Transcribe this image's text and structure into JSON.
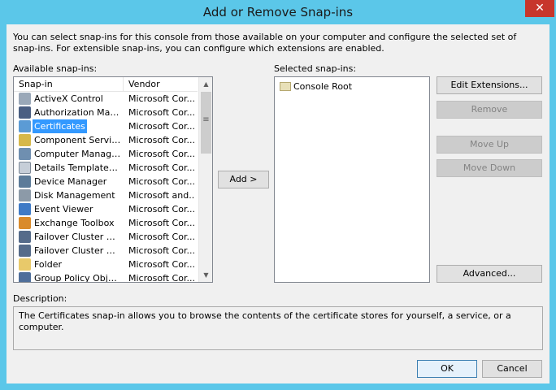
{
  "window": {
    "title": "Add or Remove Snap-ins",
    "close_glyph": "✕"
  },
  "intro_text": "You can select snap-ins for this console from those available on your computer and configure the selected set of snap-ins. For extensible snap-ins, you can configure which extensions are enabled.",
  "available": {
    "label": "Available snap-ins:",
    "columns": [
      "Snap-in",
      "Vendor"
    ],
    "rows": [
      {
        "name": "ActiveX Control",
        "vendor": "Microsoft Cor...",
        "icon": "activex-icon",
        "selected": false
      },
      {
        "name": "Authorization Manager",
        "vendor": "Microsoft Cor...",
        "icon": "authorization-manager-icon",
        "selected": false
      },
      {
        "name": "Certificates",
        "vendor": "Microsoft Cor...",
        "icon": "certificates-icon",
        "selected": true
      },
      {
        "name": "Component Services",
        "vendor": "Microsoft Cor...",
        "icon": "component-services-icon",
        "selected": false
      },
      {
        "name": "Computer Managem...",
        "vendor": "Microsoft Cor...",
        "icon": "computer-management-icon",
        "selected": false
      },
      {
        "name": "Details Templates E...",
        "vendor": "Microsoft Cor...",
        "icon": "details-templates-icon",
        "selected": false
      },
      {
        "name": "Device Manager",
        "vendor": "Microsoft Cor...",
        "icon": "device-manager-icon",
        "selected": false
      },
      {
        "name": "Disk Management",
        "vendor": "Microsoft and...",
        "icon": "disk-management-icon",
        "selected": false
      },
      {
        "name": "Event Viewer",
        "vendor": "Microsoft Cor...",
        "icon": "event-viewer-icon",
        "selected": false
      },
      {
        "name": "Exchange Toolbox",
        "vendor": "Microsoft Cor...",
        "icon": "exchange-toolbox-icon",
        "selected": false
      },
      {
        "name": "Failover Cluster Man...",
        "vendor": "Microsoft Cor...",
        "icon": "failover-cluster-icon",
        "selected": false
      },
      {
        "name": "Failover Cluster Man...",
        "vendor": "Microsoft Cor...",
        "icon": "failover-cluster-icon",
        "selected": false
      },
      {
        "name": "Folder",
        "vendor": "Microsoft Cor...",
        "icon": "folder-icon",
        "selected": false
      },
      {
        "name": "Group Policy Object ...",
        "vendor": "Microsoft Cor...",
        "icon": "group-policy-icon",
        "selected": false
      }
    ]
  },
  "add_button": "Add >",
  "selected": {
    "label": "Selected snap-ins:",
    "root": "Console Root"
  },
  "right_buttons": {
    "edit_extensions": "Edit Extensions...",
    "remove": "Remove",
    "move_up": "Move Up",
    "move_down": "Move Down",
    "advanced": "Advanced..."
  },
  "description": {
    "label": "Description:",
    "text": "The Certificates snap-in allows you to browse the contents of the certificate stores for yourself, a service, or a computer."
  },
  "footer": {
    "ok": "OK",
    "cancel": "Cancel"
  }
}
